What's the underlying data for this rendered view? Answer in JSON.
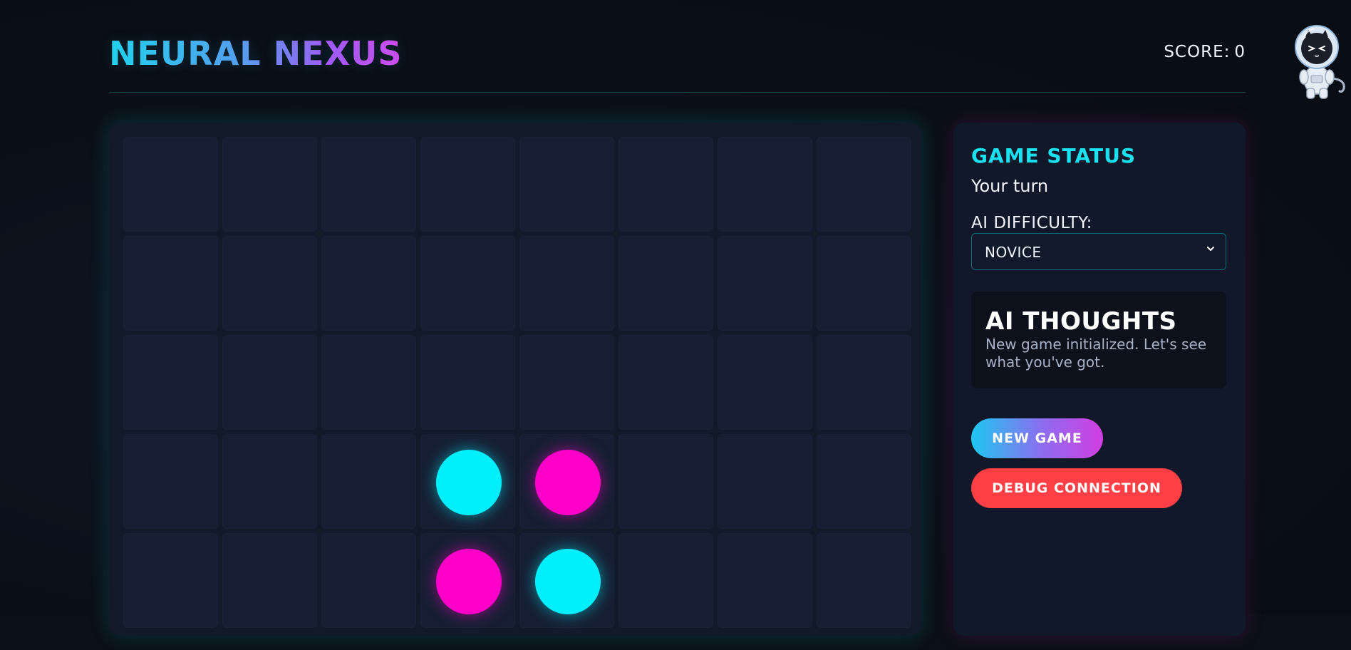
{
  "header": {
    "logo_part1": "NEURAL",
    "logo_part2": "NEXUS",
    "score_label": "SCORE:",
    "score_value": "0"
  },
  "board": {
    "rows": [
      [
        "",
        "",
        "",
        "",
        "",
        "",
        "",
        ""
      ],
      [
        "",
        "",
        "",
        "",
        "",
        "",
        "",
        ""
      ],
      [
        "",
        "",
        "",
        "",
        "",
        "",
        "",
        ""
      ],
      [
        "",
        "",
        "",
        "cyan",
        "magenta",
        "",
        "",
        ""
      ],
      [
        "",
        "",
        "",
        "magenta",
        "cyan",
        "",
        "",
        ""
      ]
    ]
  },
  "panel": {
    "status_title": "GAME STATUS",
    "status_text": "Your turn",
    "difficulty_label": "AI DIFFICULTY:",
    "difficulty_value": "NOVICE",
    "thoughts_title": "AI THOUGHTS",
    "thoughts_text": "New game initialized. Let's see what you've got.",
    "new_game_label": "NEW GAME",
    "debug_label": "DEBUG CONNECTION"
  },
  "colors": {
    "player_cyan": "#00f0fb",
    "player_magenta": "#ff00c8",
    "accent": "#17e3f0",
    "danger": "#ff3f45"
  },
  "icons": {
    "select_chevron": "chevron-down-icon",
    "mascot": "astronaut-cat-mascot"
  }
}
